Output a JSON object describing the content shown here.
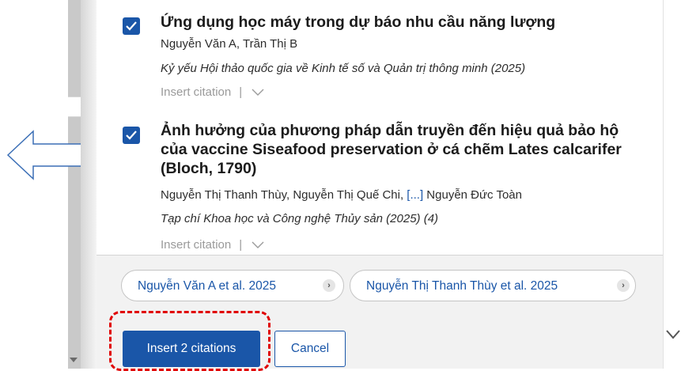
{
  "results": [
    {
      "checked": true,
      "title": "Ứng dụng học máy trong dự báo nhu cầu năng lượng",
      "authors": "Nguyễn Văn A, Trần Thị B",
      "source": "Kỷ yếu Hội thảo quốc gia về Kinh tế số và Quản trị thông minh (2025)",
      "insert_label": "Insert citation",
      "separator": "|"
    },
    {
      "checked": true,
      "title": "Ảnh hưởng của phương pháp dẫn truyền đến hiệu quả bảo hộ của vaccine Siseafood preservation ở cá chẽm Lates calcarifer (Bloch, 1790)",
      "authors_start": "Nguyễn Thị Thanh Thùy, Nguyễn Thị Quế Chi, ",
      "authors_ellipsis": "[...]",
      "authors_end": " Nguyễn Đức Toàn",
      "source": "Tạp chí Khoa học và Công nghệ Thủy sản (2025) (4)",
      "insert_label": "Insert citation",
      "separator": "|"
    }
  ],
  "chips": [
    {
      "label": "Nguyễn Văn A et al. 2025",
      "more": "›"
    },
    {
      "label": "Nguyễn Thị Thanh Thùy et al. 2025",
      "more": "›"
    }
  ],
  "buttons": {
    "insert": "Insert 2 citations",
    "cancel": "Cancel"
  },
  "colors": {
    "accent": "#1a56a8",
    "highlight": "#e00000"
  },
  "icons": [
    "checkbox-checked-icon",
    "chevron-down-icon",
    "left-arrow-icon",
    "chevron-right-icon"
  ]
}
